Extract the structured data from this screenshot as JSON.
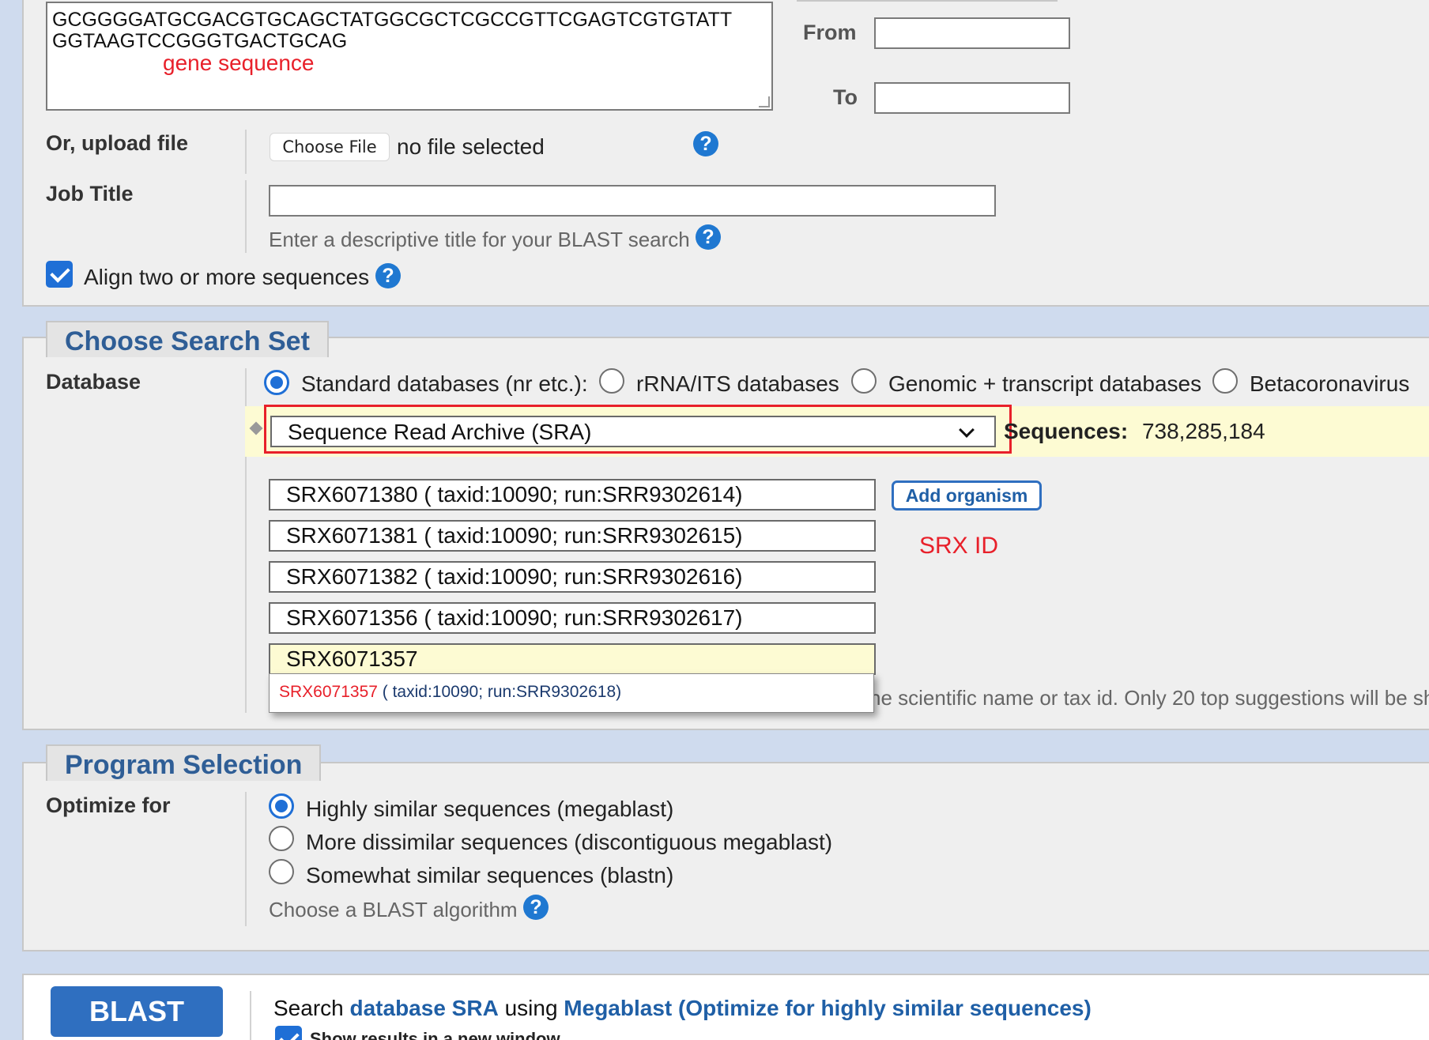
{
  "query": {
    "sequence_text": "GCGGGGATGCGACGTGCAGCTATGGCGCTCGCCGTTCGAGTCGTGTATT\nGGTAAGTCCGGGTGACTGCAG",
    "annotation": "gene sequence",
    "from_label": "From",
    "to_label": "To",
    "from_value": "",
    "to_value": ""
  },
  "upload": {
    "label": "Or, upload file",
    "button_label": "Choose File",
    "status": "no file selected"
  },
  "job": {
    "label": "Job Title",
    "value": "",
    "hint": "Enter a descriptive title for your BLAST search"
  },
  "align": {
    "label": "Align two or more sequences",
    "checked": true
  },
  "search_set": {
    "tab_label": "Choose Search Set",
    "database_label": "Database",
    "options": [
      {
        "label": "Standard databases (nr etc.):",
        "selected": true
      },
      {
        "label": "rRNA/ITS databases",
        "selected": false
      },
      {
        "label": "Genomic + transcript databases",
        "selected": false
      },
      {
        "label": "Betacoronavirus",
        "selected": false
      }
    ],
    "selected_db": "Sequence Read Archive (SRA)",
    "sequences_label": "Sequences:",
    "sequences_count": "738,285,184",
    "srx_entries": [
      "SRX6071380 ( taxid:10090; run:SRR9302614)",
      "SRX6071381 ( taxid:10090; run:SRR9302615)",
      "SRX6071382 ( taxid:10090; run:SRR9302616)",
      "SRX6071356 ( taxid:10090; run:SRR9302617)"
    ],
    "active_entry": "SRX6071357",
    "suggestion_id": "SRX6071357",
    "suggestion_rest": " ( taxid:10090; run:SRR9302618)",
    "add_organism": "Add organism",
    "srx_annotation": "SRX ID",
    "organism_hint": "ne scientific name or tax id. Only 20 top suggestions will be sh"
  },
  "program": {
    "tab_label": "Program Selection",
    "optimize_label": "Optimize for",
    "options": [
      {
        "label": "Highly similar sequences (megablast)",
        "selected": true
      },
      {
        "label": "More dissimilar sequences (discontiguous megablast)",
        "selected": false
      },
      {
        "label": "Somewhat similar sequences (blastn)",
        "selected": false
      }
    ],
    "hint": "Choose a BLAST algorithm"
  },
  "blast": {
    "button_label": "BLAST",
    "summary_prefix": "Search ",
    "summary_db": "database SRA",
    "summary_mid": " using ",
    "summary_program": "Megablast (Optimize for highly similar sequences)",
    "new_window_label": "Show results in a new window"
  },
  "colors": {
    "accent": "#1f6fd6",
    "tab_text": "#2f5e96",
    "annotation_red": "#e8202a",
    "highlight_row": "#fdfbd3"
  }
}
